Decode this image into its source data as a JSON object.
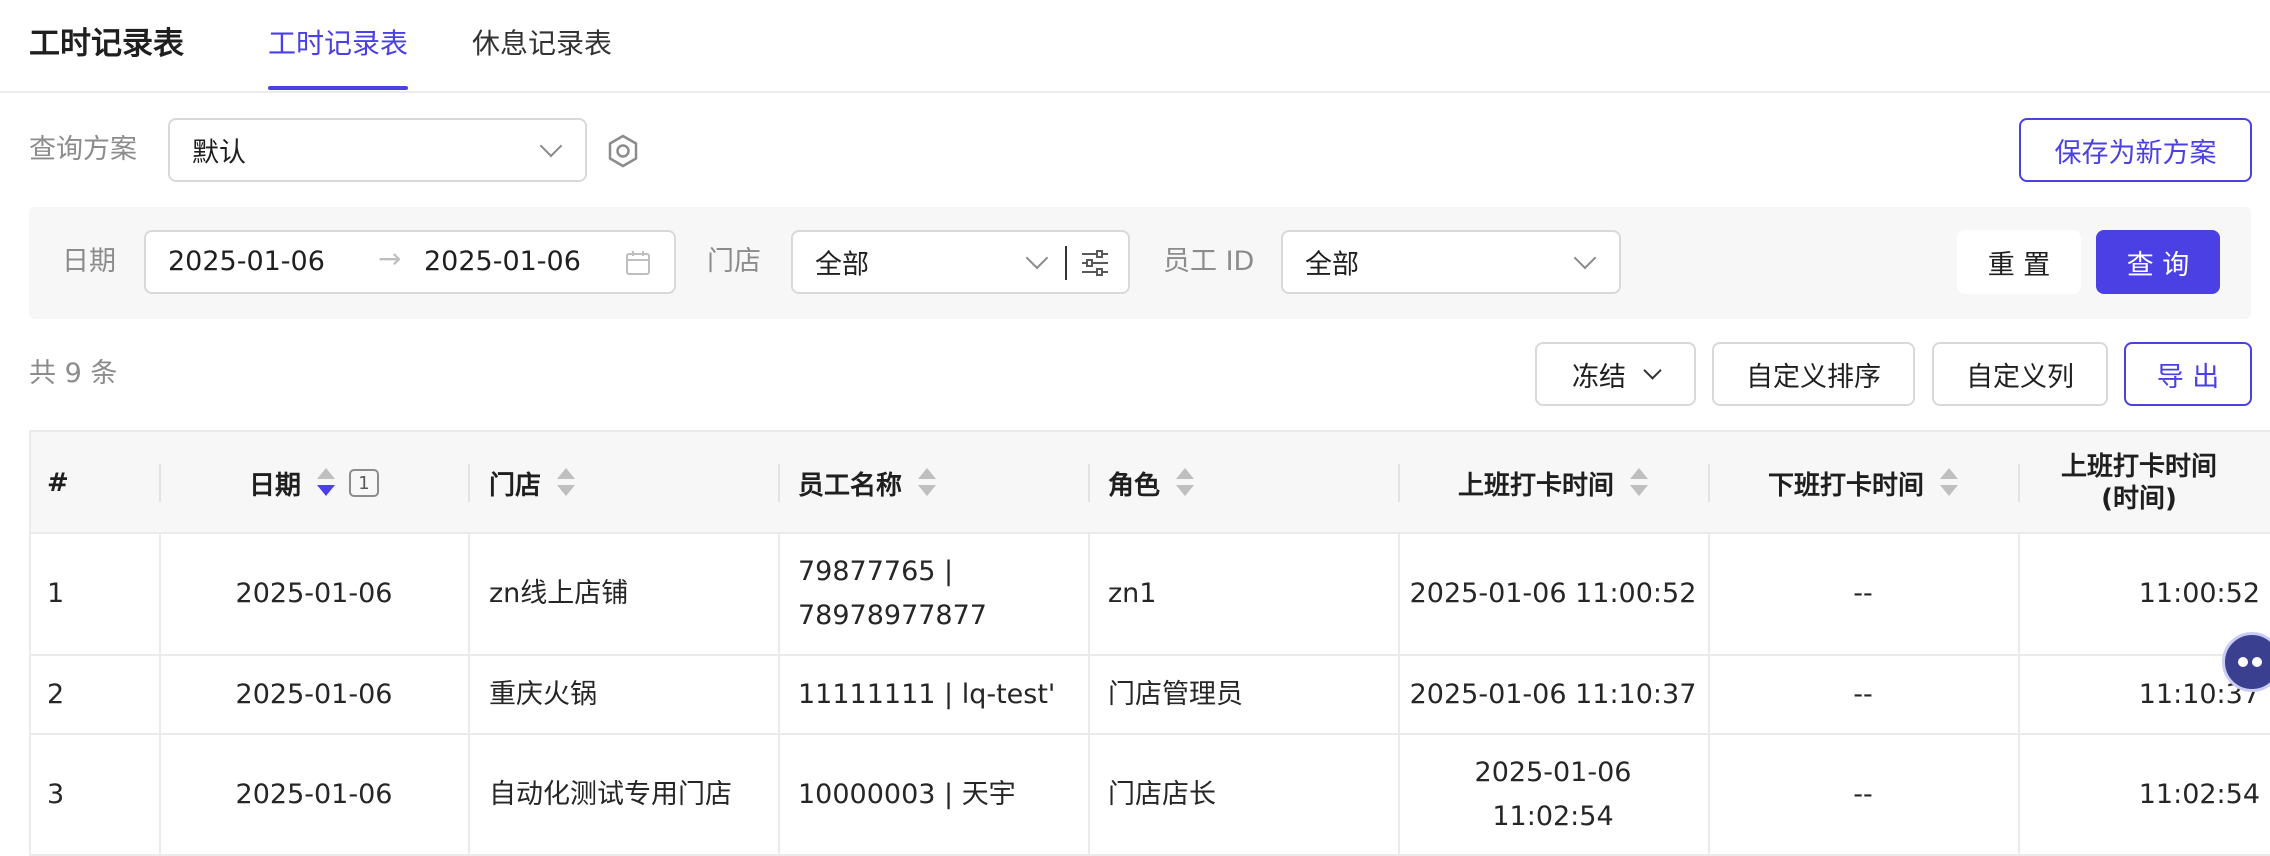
{
  "app": {
    "title": "工时记录表"
  },
  "tabs": [
    {
      "label": "工时记录表",
      "active": true
    },
    {
      "label": "休息记录表",
      "active": false
    }
  ],
  "scheme": {
    "label": "查询方案",
    "value": "默认",
    "save_label": "保存为新方案"
  },
  "filters": {
    "date_label": "日期",
    "date_start": "2025-01-06",
    "date_end": "2025-01-06",
    "store_label": "门店",
    "store_value": "全部",
    "employee_label": "员工 ID",
    "employee_value": "全部",
    "reset_label": "重 置",
    "query_label": "查 询"
  },
  "toolbar": {
    "count_text": "共 9 条",
    "freeze_label": "冻结",
    "custom_sort_label": "自定义排序",
    "custom_cols_label": "自定义列",
    "export_label": "导 出"
  },
  "table": {
    "columns": [
      "#",
      "日期",
      "门店",
      "员工名称",
      "角色",
      "上班打卡时间",
      "下班打卡时间",
      "上班打卡时间",
      "(时间)"
    ],
    "sort_badge": "1",
    "rows": [
      {
        "idx": "1",
        "date": "2025-01-06",
        "store": "zn线上店铺",
        "emp_a": "79877765 |",
        "emp_b": "78978977877",
        "role": "zn1",
        "in_a": "2025-01-06 11:00:52",
        "in_b": "",
        "out": "--",
        "in_time": "11:00:52"
      },
      {
        "idx": "2",
        "date": "2025-01-06",
        "store": "重庆火锅",
        "emp_a": "11111111 | lq-test'",
        "emp_b": "",
        "role": "门店管理员",
        "in_a": "2025-01-06 11:10:37",
        "in_b": "",
        "out": "--",
        "in_time": "11:10:37"
      },
      {
        "idx": "3",
        "date": "2025-01-06",
        "store": "自动化测试专用门店",
        "emp_a": "10000003 | 天宇",
        "emp_b": "",
        "role": "门店店长",
        "in_a": "2025-01-06",
        "in_b": "11:02:54",
        "out": "--",
        "in_time": "11:02:54"
      }
    ]
  },
  "colors": {
    "primary": "#4a40e3",
    "border": "#d9d9d9",
    "panel": "#f7f7f8"
  }
}
